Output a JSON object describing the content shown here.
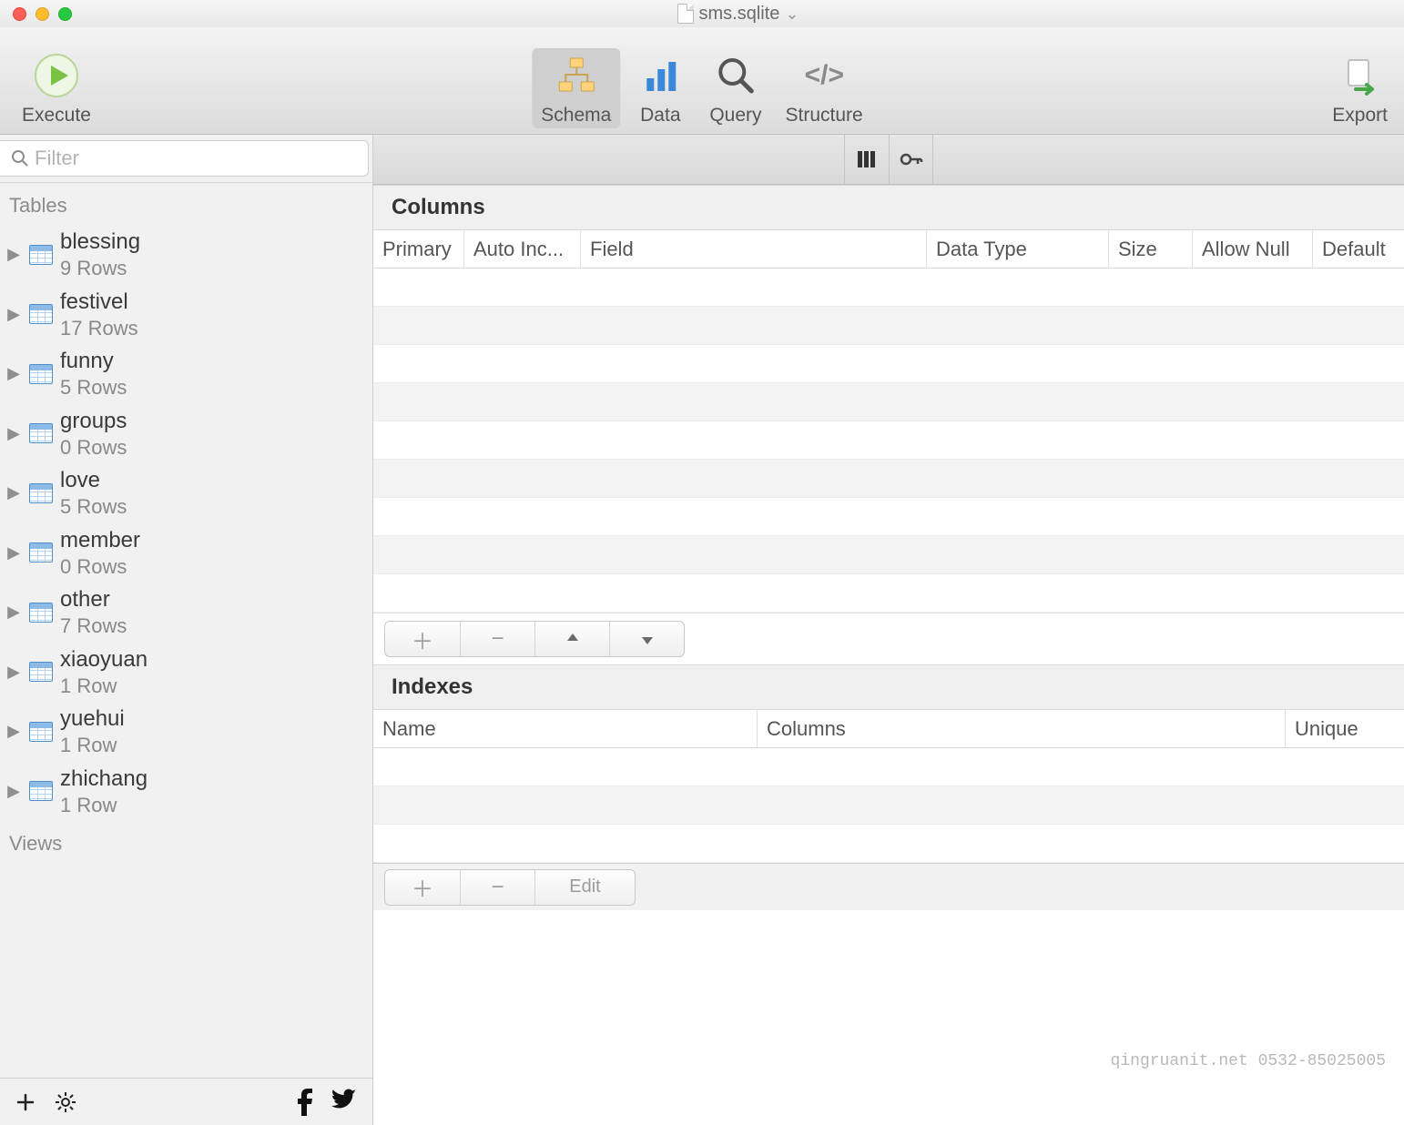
{
  "title": {
    "filename": "sms.sqlite"
  },
  "toolbar": {
    "execute": "Execute",
    "schema": "Schema",
    "data": "Data",
    "query": "Query",
    "structure": "Structure",
    "export": "Export"
  },
  "sidebar": {
    "filter_placeholder": "Filter",
    "tables_label": "Tables",
    "views_label": "Views",
    "tables": [
      {
        "name": "blessing",
        "rows": "9 Rows"
      },
      {
        "name": "festivel",
        "rows": "17 Rows"
      },
      {
        "name": "funny",
        "rows": "5 Rows"
      },
      {
        "name": "groups",
        "rows": "0 Rows"
      },
      {
        "name": "love",
        "rows": "5 Rows"
      },
      {
        "name": "member",
        "rows": "0 Rows"
      },
      {
        "name": "other",
        "rows": "7 Rows"
      },
      {
        "name": "xiaoyuan",
        "rows": "1 Row"
      },
      {
        "name": "yuehui",
        "rows": "1 Row"
      },
      {
        "name": "zhichang",
        "rows": "1 Row"
      }
    ]
  },
  "main": {
    "columns_label": "Columns",
    "indexes_label": "Indexes",
    "column_headers": {
      "primary": "Primary",
      "autoinc": "Auto Inc...",
      "field": "Field",
      "datatype": "Data Type",
      "size": "Size",
      "allownull": "Allow Null",
      "default": "Default"
    },
    "index_headers": {
      "name": "Name",
      "columns": "Columns",
      "unique": "Unique"
    },
    "edit_label": "Edit"
  },
  "watermark": "qingruanit.net 0532-85025005"
}
